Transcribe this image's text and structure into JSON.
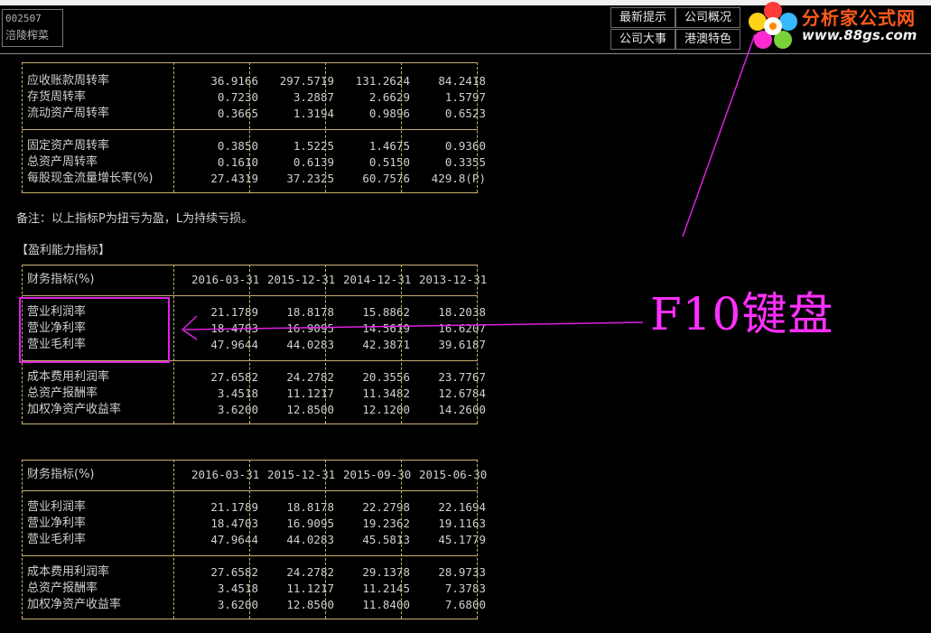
{
  "stock": {
    "code": "002507",
    "name": "涪陵榨菜"
  },
  "nav": {
    "latest_tips": "最新提示",
    "company_overview": "公司概况",
    "company_events": "公司大事",
    "hk_features": "港澳特色"
  },
  "logo": {
    "name": "分析家公式网",
    "url": "www.88gs.com"
  },
  "annotation": {
    "text": "F10键盘",
    "color": "#ff30ff"
  },
  "turnover": {
    "rows1": [
      {
        "label": "应收账款周转率",
        "values": [
          "36.9166",
          "297.5719",
          "131.2624",
          "84.2418"
        ]
      },
      {
        "label": "存货周转率",
        "values": [
          "0.7230",
          "3.2887",
          "2.6629",
          "1.5797"
        ]
      },
      {
        "label": "流动资产周转率",
        "values": [
          "0.3665",
          "1.3194",
          "0.9896",
          "0.6523"
        ]
      }
    ],
    "rows2": [
      {
        "label": "固定资产周转率",
        "values": [
          "0.3850",
          "1.5225",
          "1.4675",
          "0.9360"
        ]
      },
      {
        "label": "总资产周转率",
        "values": [
          "0.1610",
          "0.6139",
          "0.5150",
          "0.3355"
        ]
      },
      {
        "label": "每股现金流量增长率(%)",
        "values": [
          "27.4319",
          "37.2325",
          "60.7576",
          "429.8(P)"
        ]
      }
    ]
  },
  "note": "备注：以上指标P为扭亏为盈，L为持续亏损。",
  "profit_section_title": "【盈利能力指标】",
  "profit_table1": {
    "header": "财务指标(%)",
    "dates": [
      "2016-03-31",
      "2015-12-31",
      "2014-12-31",
      "2013-12-31"
    ],
    "rows1": [
      {
        "label": "营业利润率",
        "values": [
          "21.1789",
          "18.8178",
          "15.8862",
          "18.2038"
        ]
      },
      {
        "label": "营业净利率",
        "values": [
          "18.4703",
          "16.9095",
          "14.5619",
          "16.6207"
        ]
      },
      {
        "label": "营业毛利率",
        "values": [
          "47.9644",
          "44.0283",
          "42.3871",
          "39.6187"
        ]
      }
    ],
    "rows2": [
      {
        "label": "成本费用利润率",
        "values": [
          "27.6582",
          "24.2782",
          "20.3556",
          "23.7767"
        ]
      },
      {
        "label": "总资产报酬率",
        "values": [
          "3.4518",
          "11.1217",
          "11.3482",
          "12.6784"
        ]
      },
      {
        "label": "加权净资产收益率",
        "values": [
          "3.6200",
          "12.8500",
          "12.1200",
          "14.2600"
        ]
      }
    ]
  },
  "profit_table2": {
    "header": "财务指标(%)",
    "dates": [
      "2016-03-31",
      "2015-12-31",
      "2015-09-30",
      "2015-06-30"
    ],
    "rows1": [
      {
        "label": "营业利润率",
        "values": [
          "21.1789",
          "18.8178",
          "22.2798",
          "22.1694"
        ]
      },
      {
        "label": "营业净利率",
        "values": [
          "18.4703",
          "16.9095",
          "19.2362",
          "19.1163"
        ]
      },
      {
        "label": "营业毛利率",
        "values": [
          "47.9644",
          "44.0283",
          "45.5813",
          "45.1779"
        ]
      }
    ],
    "rows2": [
      {
        "label": "成本费用利润率",
        "values": [
          "27.6582",
          "24.2782",
          "29.1378",
          "28.9733"
        ]
      },
      {
        "label": "总资产报酬率",
        "values": [
          "3.4518",
          "11.1217",
          "11.2145",
          "7.3783"
        ]
      },
      {
        "label": "加权净资产收益率",
        "values": [
          "3.6200",
          "12.8500",
          "11.8400",
          "7.6800"
        ]
      }
    ]
  }
}
